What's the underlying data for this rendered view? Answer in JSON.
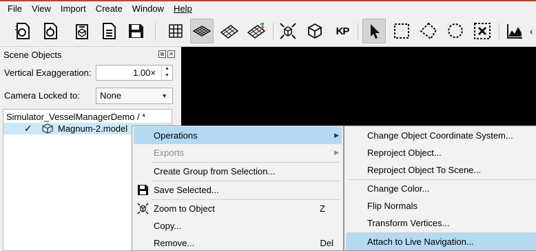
{
  "menubar": {
    "items": [
      {
        "label": "File",
        "underline": false
      },
      {
        "label": "View",
        "underline": false
      },
      {
        "label": "Import",
        "underline": false
      },
      {
        "label": "Create",
        "underline": false
      },
      {
        "label": "Window",
        "underline": false
      },
      {
        "label": "Help",
        "underline": true
      }
    ]
  },
  "toolbar": {
    "buttons": [
      {
        "icon": "open-scene-icon",
        "active": false
      },
      {
        "icon": "open-file-icon",
        "active": false
      },
      {
        "icon": "import-model-icon",
        "active": false
      },
      {
        "icon": "import-document-icon",
        "active": false
      },
      {
        "icon": "save-icon",
        "active": false
      },
      {
        "icon": "grid-icon",
        "active": false
      },
      {
        "icon": "surface-grid-icon",
        "active": true
      },
      {
        "icon": "wireframe-grid-icon",
        "active": false
      },
      {
        "icon": "colored-grid-icon",
        "active": false
      },
      {
        "icon": "zoom-extents-icon",
        "active": false
      },
      {
        "icon": "box-3d-icon",
        "active": false
      },
      {
        "icon": "kp-icon",
        "active": false
      },
      {
        "icon": "select-pointer-icon",
        "active": true
      },
      {
        "icon": "rect-select-icon",
        "active": false
      },
      {
        "icon": "polygon-select-icon",
        "active": false
      },
      {
        "icon": "lasso-select-icon",
        "active": false
      },
      {
        "icon": "clear-selection-icon",
        "active": false
      },
      {
        "icon": "profile-chart-icon",
        "active": false
      }
    ],
    "kp_label": "KP"
  },
  "panel": {
    "title": "Scene Objects",
    "vertical_exaggeration_label": "Vertical Exaggeration:",
    "vertical_exaggeration_value": "1.00×",
    "camera_locked_label": "Camera Locked to:",
    "camera_locked_value": "None",
    "tree_root": "Simulator_VesselManagerDemo / *",
    "tree_item": "Magnum-2.model",
    "tree_item_checked": true
  },
  "context_menu": {
    "items": [
      {
        "label": "Operations",
        "shortcut": "",
        "submenu": true,
        "highlighted": true,
        "disabled": false,
        "icon": ""
      },
      {
        "label": "Exports",
        "shortcut": "",
        "submenu": true,
        "highlighted": false,
        "disabled": true,
        "icon": ""
      },
      {
        "label": "Create Group from Selection...",
        "shortcut": "",
        "submenu": false,
        "highlighted": false,
        "disabled": false,
        "icon": ""
      },
      {
        "label": "Save Selected...",
        "shortcut": "",
        "submenu": false,
        "highlighted": false,
        "disabled": false,
        "icon": "save-icon"
      },
      {
        "label": "Zoom to Object",
        "shortcut": "Z",
        "submenu": false,
        "highlighted": false,
        "disabled": false,
        "icon": "zoom-to-object-icon"
      },
      {
        "label": "Copy...",
        "shortcut": "",
        "submenu": false,
        "highlighted": false,
        "disabled": false,
        "icon": ""
      },
      {
        "label": "Remove...",
        "shortcut": "Del",
        "submenu": false,
        "highlighted": false,
        "disabled": false,
        "icon": ""
      }
    ]
  },
  "submenu": {
    "items": [
      {
        "label": "Change Object Coordinate System...",
        "highlighted": false
      },
      {
        "label": "Reproject Object...",
        "highlighted": false
      },
      {
        "label": "Reproject Object To Scene...",
        "highlighted": false
      },
      {
        "label": "Change Color...",
        "highlighted": false
      },
      {
        "label": "Flip Normals",
        "highlighted": false
      },
      {
        "label": "Transform Vertices...",
        "highlighted": false
      },
      {
        "label": "Attach to Live Navigation...",
        "highlighted": true
      }
    ]
  },
  "colors": {
    "highlight": "#b5d9f1",
    "selection_row": "#cce8f6",
    "viewport": "#000000",
    "top_accent": "#d8342a"
  }
}
